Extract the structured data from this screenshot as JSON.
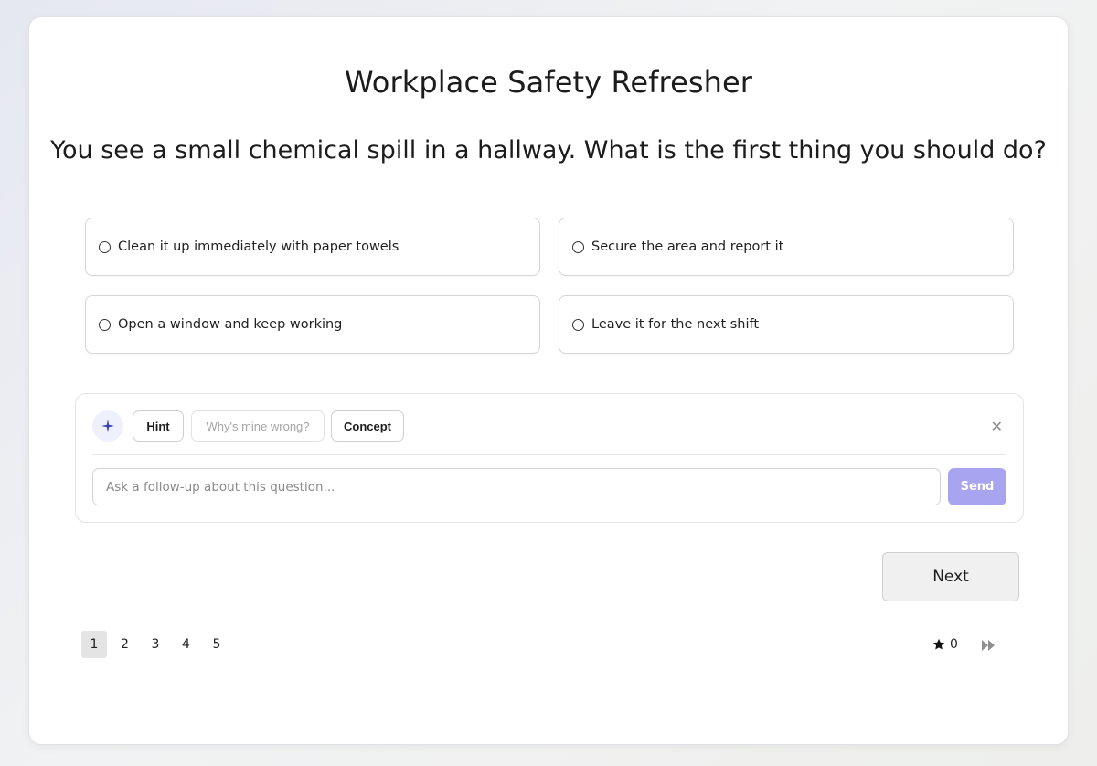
{
  "quiz": {
    "title": "Workplace Safety Refresher",
    "question": "You see a small chemical spill in a hallway. What is the first thing you should do?",
    "options": [
      "Clean it up immediately with paper towels",
      "Secure the area and report it",
      "Open a window and keep working",
      "Leave it for the next shift"
    ]
  },
  "assistant": {
    "icon": "sparkle-icon",
    "chips": {
      "hint": "Hint",
      "why_wrong": "Why's mine wrong?",
      "concept": "Concept"
    },
    "close_icon": "close-icon",
    "input_placeholder": "Ask a follow-up about this question...",
    "input_value": "",
    "send_label": "Send",
    "send_color": "#a9a4ef"
  },
  "navigation": {
    "next_label": "Next",
    "pages": [
      "1",
      "2",
      "3",
      "4",
      "5"
    ],
    "current_page": "1",
    "stars_count": "0",
    "skip_icon": "fast-forward-icon"
  }
}
